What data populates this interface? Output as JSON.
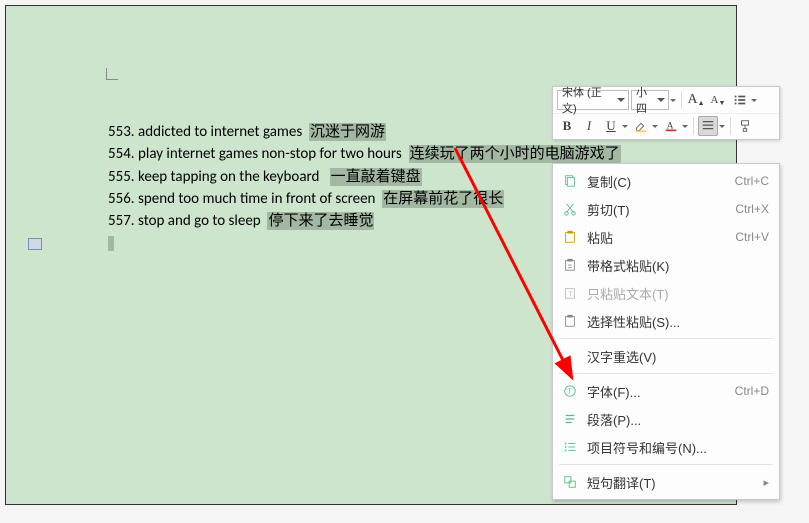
{
  "document": {
    "lines": [
      {
        "num": "553.",
        "en": "addicted to internet games",
        "zh": "沉迷于网游"
      },
      {
        "num": "554.",
        "en": "play internet games non-stop for two hours",
        "zh": "连续玩了两个小时的电脑游戏了"
      },
      {
        "num": "555.",
        "en": "keep tapping on the keyboard",
        "zh": "一直敲着键盘"
      },
      {
        "num": "556.",
        "en": "spend too much time in front of screen",
        "zh": "在屏幕前花了很长"
      },
      {
        "num": "557.",
        "en": "stop and go to sleep",
        "zh": "停下来了去睡觉"
      }
    ]
  },
  "miniToolbar": {
    "font": "宋体 (正文)",
    "size": "小四",
    "row2": {
      "bold": "B",
      "italic": "I",
      "underline": "U"
    }
  },
  "contextMenu": {
    "items": [
      {
        "icon": "copy",
        "label": "复制(C)",
        "shortcut": "Ctrl+C"
      },
      {
        "icon": "cut",
        "label": "剪切(T)",
        "shortcut": "Ctrl+X"
      },
      {
        "icon": "paste",
        "label": "粘贴",
        "shortcut": "Ctrl+V"
      },
      {
        "icon": "paste-fmt",
        "label": "带格式粘贴(K)",
        "shortcut": ""
      },
      {
        "icon": "paste-text",
        "label": "只粘贴文本(T)",
        "shortcut": "",
        "disabled": true
      },
      {
        "icon": "paste-special",
        "label": "选择性粘贴(S)...",
        "shortcut": ""
      },
      {
        "sep": true
      },
      {
        "icon": "reconvert",
        "label": "汉字重选(V)",
        "shortcut": ""
      },
      {
        "sep": true
      },
      {
        "icon": "font",
        "label": "字体(F)...",
        "shortcut": "Ctrl+D"
      },
      {
        "icon": "paragraph",
        "label": "段落(P)...",
        "shortcut": ""
      },
      {
        "icon": "bullets",
        "label": "项目符号和编号(N)...",
        "shortcut": ""
      },
      {
        "sep": true
      },
      {
        "icon": "translate",
        "label": "短句翻译(T)",
        "shortcut": "",
        "arrow": true
      }
    ]
  }
}
